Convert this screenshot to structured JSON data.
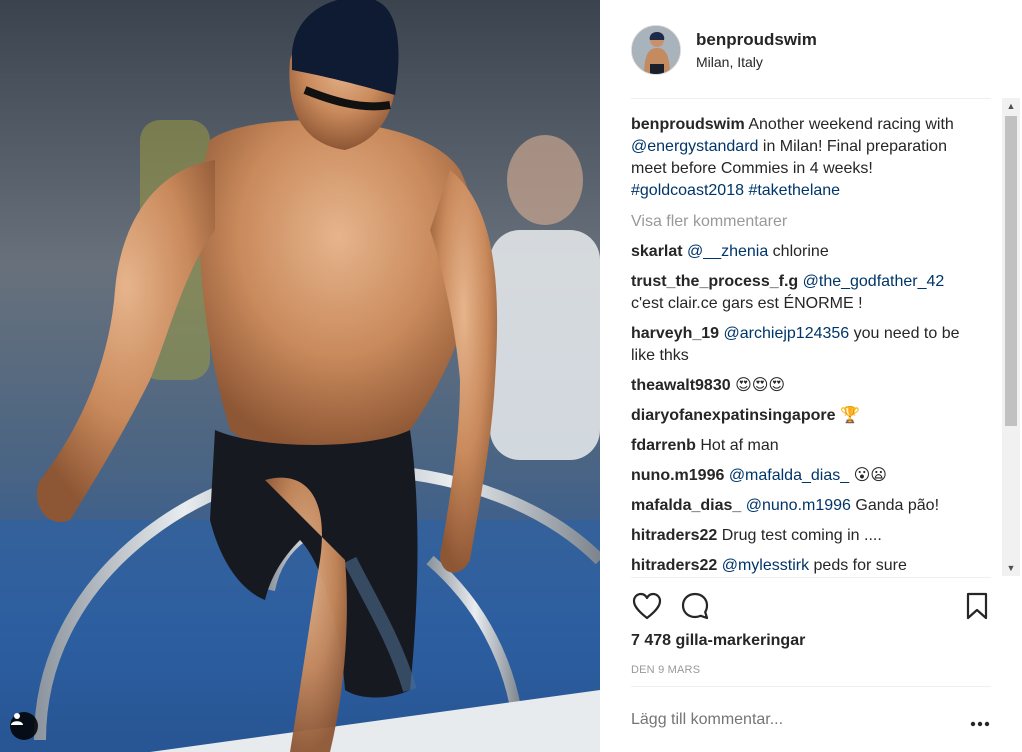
{
  "post": {
    "username": "benproudswim",
    "location": "Milan, Italy",
    "caption": {
      "username": "benproudswim",
      "parts": [
        {
          "text": " Another weekend racing with ",
          "mention": false
        },
        {
          "text": "@energystandard",
          "mention": true
        },
        {
          "text": " in Milan! Final preparation meet before Commies in 4 weeks! ",
          "mention": false
        },
        {
          "text": "#goldcoast2018",
          "mention": true
        },
        {
          "text": " ",
          "mention": false
        },
        {
          "text": "#takethelane",
          "mention": true
        }
      ]
    },
    "view_more_label": "Visa fler kommentarer",
    "comments": [
      {
        "user": "skarlat",
        "parts": [
          {
            "text": "@__zhenia",
            "mention": true
          },
          {
            "text": " chlorine",
            "mention": false
          }
        ]
      },
      {
        "user": "trust_the_process_f.g",
        "parts": [
          {
            "text": "@the_godfather_42",
            "mention": true
          },
          {
            "text": " c'est clair.ce gars est ÉNORME !",
            "mention": false
          }
        ]
      },
      {
        "user": "harveyh_19",
        "parts": [
          {
            "text": "@archiejp124356",
            "mention": true
          },
          {
            "text": " you need to be like thks",
            "mention": false
          }
        ]
      },
      {
        "user": "theawalt9830",
        "parts": [
          {
            "text": "😍😍😍",
            "mention": false
          }
        ]
      },
      {
        "user": "diaryofanexpatinsingapore",
        "parts": [
          {
            "text": "🏆",
            "mention": false
          }
        ]
      },
      {
        "user": "fdarrenb",
        "parts": [
          {
            "text": "Hot af man",
            "mention": false
          }
        ]
      },
      {
        "user": "nuno.m1996",
        "parts": [
          {
            "text": "@mafalda_dias_",
            "mention": true
          },
          {
            "text": " 😮😦",
            "mention": false
          }
        ]
      },
      {
        "user": "mafalda_dias_",
        "parts": [
          {
            "text": "@nuno.m1996",
            "mention": true
          },
          {
            "text": " Ganda pão!",
            "mention": false
          }
        ]
      },
      {
        "user": "hitraders22",
        "parts": [
          {
            "text": "Drug test coming in ....",
            "mention": false
          }
        ]
      },
      {
        "user": "hitraders22",
        "parts": [
          {
            "text": "@mylesstirk",
            "mention": true
          },
          {
            "text": " peds for sure",
            "mention": false
          }
        ]
      }
    ],
    "likes_label": "7 478 gilla-markeringar",
    "date_label": "DEN 9 MARS",
    "add_comment_placeholder": "Lägg till kommentar...",
    "icons": {
      "like": "heart-outline-icon",
      "comment": "speech-bubble-icon",
      "save": "bookmark-icon",
      "options": "ellipsis-icon",
      "tag": "user-tag-icon",
      "scroll_up": "arrow-up-icon",
      "scroll_down": "arrow-down-icon"
    },
    "colors": {
      "text": "#262626",
      "mention": "#003569",
      "muted": "#999999",
      "divider": "#efefef"
    }
  }
}
